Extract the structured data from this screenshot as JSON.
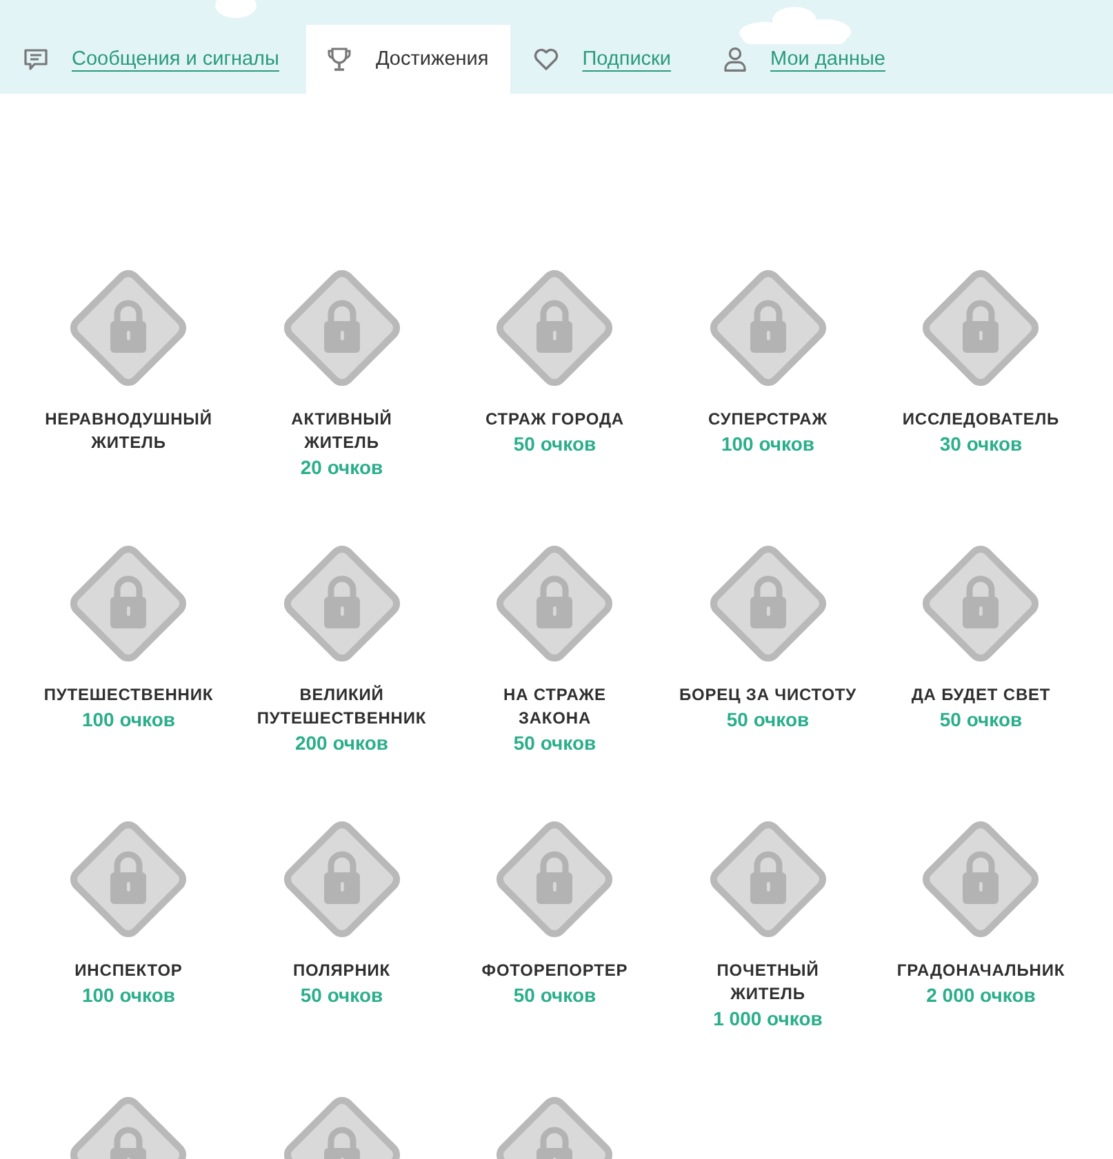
{
  "tabs": [
    {
      "label": "Сообщения и сигналы",
      "selected": false
    },
    {
      "label": "Достижения",
      "selected": true
    },
    {
      "label": "Подписки",
      "selected": false
    },
    {
      "label": "Мои данные",
      "selected": false
    }
  ],
  "achievements": [
    {
      "title": "НЕРАВНОДУШНЫЙ\nЖИТЕЛЬ",
      "locked": true
    },
    {
      "title": "АКТИВНЫЙ\nЖИТЕЛЬ",
      "points": "20 очков",
      "locked": true
    },
    {
      "title": "СТРАЖ ГОРОДА",
      "points": "50 очков",
      "locked": true
    },
    {
      "title": "СУПЕРСТРАЖ",
      "points": "100 очков",
      "locked": true
    },
    {
      "title": "ИССЛЕДОВАТЕЛЬ",
      "points": "30 очков",
      "locked": true
    },
    {
      "title": "ПУТЕШЕСТВЕННИК",
      "points": "100 очков",
      "locked": true
    },
    {
      "title": "ВЕЛИКИЙ\nПУТЕШЕСТВЕННИК",
      "points": "200 очков",
      "locked": true
    },
    {
      "title": "НА СТРАЖЕ\nЗАКОНА",
      "points": "50 очков",
      "locked": true
    },
    {
      "title": "БОРЕЦ ЗА ЧИСТОТУ",
      "points": "50 очков",
      "locked": true
    },
    {
      "title": "ДА БУДЕТ СВЕТ",
      "points": "50 очков",
      "locked": true
    },
    {
      "title": "ИНСПЕКТОР",
      "points": "100 очков",
      "locked": true
    },
    {
      "title": "ПОЛЯРНИК",
      "points": "50 очков",
      "locked": true
    },
    {
      "title": "ФОТОРЕПОРТЕР",
      "points": "50 очков",
      "locked": true
    },
    {
      "title": "ПОЧЕТНЫЙ\nЖИТЕЛЬ",
      "points": "1 000 очков",
      "locked": true
    },
    {
      "title": "ГРАДОНАЧАЛЬНИК",
      "points": "2 000 очков",
      "locked": true
    },
    {
      "locked": true
    },
    {
      "locked": true
    },
    {
      "locked": true
    }
  ]
}
